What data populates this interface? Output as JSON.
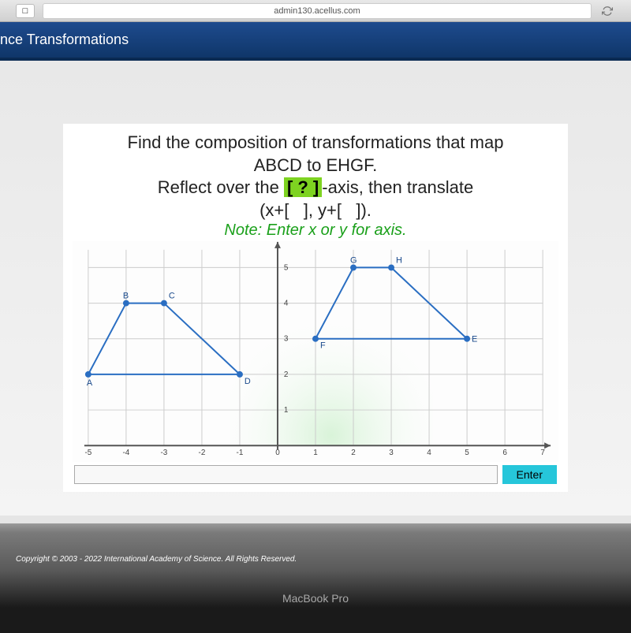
{
  "browser": {
    "url": "admin130.acellus.com",
    "reader_icon": "□"
  },
  "header": {
    "title": "nce Transformations"
  },
  "problem": {
    "line1": "Find the composition of transformations that map",
    "line2": "ABCD to EHGF.",
    "line3_a": "Reflect over the ",
    "line3_blank": "[ ? ]",
    "line3_b": "-axis, then translate",
    "line4_a": "(x+[ ",
    "line4_b": " ], y+[ ",
    "line4_c": " ]).",
    "note": "Note: Enter x or y for axis."
  },
  "answer": {
    "placeholder": "",
    "enter_label": "Enter"
  },
  "footer": {
    "copyright": "Copyright © 2003 - 2022 International Academy of Science.  All Rights Reserved.",
    "laptop": "MacBook Pro"
  },
  "chart_data": {
    "type": "scatter",
    "title": "",
    "xlabel": "",
    "ylabel": "",
    "xlim": [
      -5,
      7
    ],
    "ylim": [
      0,
      5.5
    ],
    "xticks": [
      -5,
      -4,
      -3,
      -2,
      -1,
      0,
      1,
      2,
      3,
      4,
      5,
      6,
      7
    ],
    "yticks": [
      1,
      2,
      3,
      4,
      5
    ],
    "shapes": [
      {
        "name": "ABCD",
        "points": [
          {
            "label": "A",
            "x": -5,
            "y": 2
          },
          {
            "label": "B",
            "x": -4,
            "y": 4
          },
          {
            "label": "C",
            "x": -3,
            "y": 4
          },
          {
            "label": "D",
            "x": -1,
            "y": 2
          }
        ]
      },
      {
        "name": "EHGF",
        "points": [
          {
            "label": "E",
            "x": 5,
            "y": 3
          },
          {
            "label": "H",
            "x": 3,
            "y": 5
          },
          {
            "label": "G",
            "x": 2,
            "y": 5
          },
          {
            "label": "F",
            "x": 1,
            "y": 3
          }
        ]
      }
    ]
  }
}
